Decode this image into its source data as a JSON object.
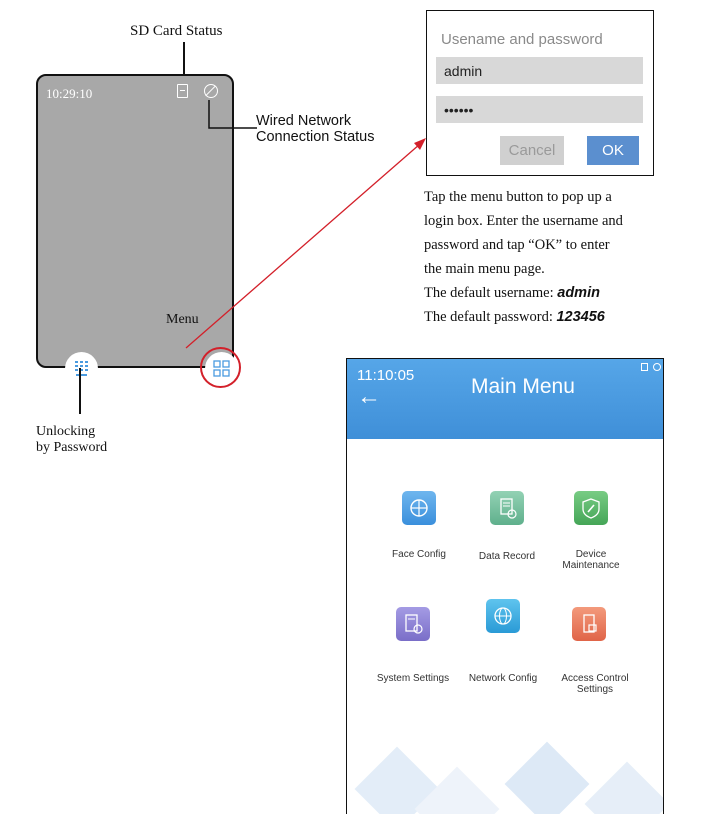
{
  "device": {
    "time": "10:29:10",
    "sd_label": "SD Card Status",
    "network_label_line1": "Wired Network",
    "network_label_line2": "Connection Status",
    "menu_label": "Menu",
    "unlock_label_line1": "Unlocking",
    "unlock_label_line2": "by Password"
  },
  "login": {
    "title": "Usename and password",
    "username_value": "admin",
    "password_value": "••••••",
    "cancel_label": "Cancel",
    "ok_label": "OK"
  },
  "instructions": {
    "line1": "Tap the menu button to pop up a",
    "line2": "login box. Enter the username and",
    "line3": "password and tap “OK” to enter",
    "line4": "the main menu page.",
    "user_prefix": "The default username: ",
    "user_value": "admin",
    "pass_prefix": "The default password: ",
    "pass_value": "123456"
  },
  "main_menu": {
    "time": "11:10:05",
    "title": "Main Menu",
    "back_icon": "←",
    "items": [
      {
        "label": "Face Config",
        "icon": "face-config-icon",
        "color": "#4a9be0"
      },
      {
        "label": "Data Record",
        "icon": "data-record-icon",
        "color": "#7cc4a4"
      },
      {
        "label": "Device Maintenance",
        "icon": "device-maintenance-icon",
        "color": "#5fba6e"
      },
      {
        "label": "System Settings",
        "icon": "system-settings-icon",
        "color": "#8f84d8"
      },
      {
        "label": "Network Config",
        "icon": "network-config-icon",
        "color": "#3fb0e0"
      },
      {
        "label": "Access Control Settings",
        "icon": "access-control-icon",
        "color": "#ef7a5e"
      }
    ]
  },
  "colors": {
    "accent_red": "#d3202a",
    "header_blue": "#4a9be0",
    "ok_blue": "#5b8fcf"
  }
}
